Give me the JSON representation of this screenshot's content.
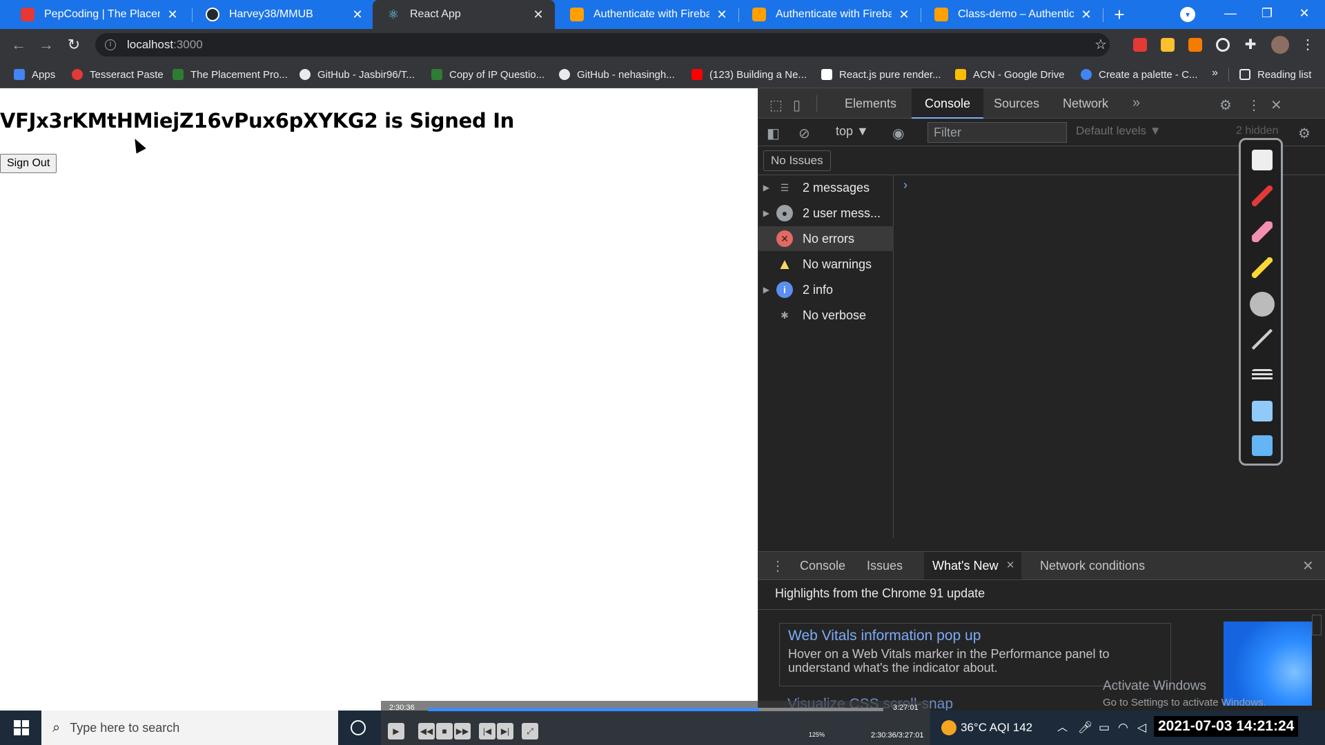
{
  "tabs": [
    {
      "title": "PepCoding | The Placement",
      "close": "✕",
      "color": "#e53935"
    },
    {
      "title": "Harvey38/MMUB",
      "close": "✕",
      "color": "#24292e"
    },
    {
      "title": "React App",
      "close": "✕",
      "color": "#61dafb"
    },
    {
      "title": "Authenticate with Firebase",
      "close": "✕",
      "color": "#ffa000"
    },
    {
      "title": "Authenticate with Firebase",
      "close": "✕",
      "color": "#ffa000"
    },
    {
      "title": "Class-demo – Authenticatio",
      "close": "✕",
      "color": "#ffa000"
    }
  ],
  "window": {
    "new_tab": "+",
    "minimize": "—",
    "restore": "❐",
    "close": "✕"
  },
  "address": {
    "host": "localhost",
    "port": ":3000"
  },
  "bookmarks": [
    {
      "label": "Apps",
      "color": "#4285f4"
    },
    {
      "label": "Tesseract Paste",
      "color": "#e53935"
    },
    {
      "label": "The Placement Pro...",
      "color": "#2e7d32"
    },
    {
      "label": "GitHub - Jasbir96/T...",
      "color": "#e8eaed"
    },
    {
      "label": "Copy of IP Questio...",
      "color": "#2e7d32"
    },
    {
      "label": "GitHub - nehasingh...",
      "color": "#e8eaed"
    },
    {
      "label": "(123) Building a Ne...",
      "color": "#ff0000"
    },
    {
      "label": "React.js pure render...",
      "color": "#ffffff"
    },
    {
      "label": "ACN - Google Drive",
      "color": "#fbbc04"
    },
    {
      "label": "Create a palette - C...",
      "color": "#4285f4"
    }
  ],
  "bookmarks_more": "»",
  "reading_list": "Reading list",
  "page": {
    "heading": "VFJx3rKMtHMiejZ16vPux6pXYKG2 is Signed In",
    "sign_out": "Sign Out"
  },
  "devtools": {
    "tabs": [
      "Elements",
      "Console",
      "Sources",
      "Network"
    ],
    "more_tabs": "»",
    "context": "top ▼",
    "filter_placeholder": "Filter",
    "levels": "Default levels ▼",
    "hidden": "2 hidden",
    "no_issues": "No Issues",
    "sidebar": [
      {
        "label": "2 messages",
        "icon": "list-icon",
        "expandable": true
      },
      {
        "label": "2 user mess...",
        "icon": "user-icon",
        "expandable": true
      },
      {
        "label": "No errors",
        "icon": "error-icon",
        "expandable": false
      },
      {
        "label": "No warnings",
        "icon": "warning-icon",
        "expandable": false
      },
      {
        "label": "2 info",
        "icon": "info-icon",
        "expandable": true
      },
      {
        "label": "No verbose",
        "icon": "bug-icon",
        "expandable": false
      }
    ],
    "prompt": "›",
    "drawer_tabs": [
      "Console",
      "Issues",
      "What's New",
      "Network conditions"
    ],
    "whats_new": {
      "title": "Highlights from the Chrome 91 update",
      "card_title": "Web Vitals information pop up",
      "card_text": "Hover on a Web Vitals marker in the Performance panel to understand what's the indicator about.",
      "next_title": "Visualize CSS scroll-snap"
    }
  },
  "activate": {
    "line1": "Activate Windows",
    "line2": "Go to Settings to activate Windows."
  },
  "taskbar": {
    "search_placeholder": "Type here to search",
    "media_elapsed": "2:30:36",
    "media_total": "3:27:01",
    "media_progress": 0.727,
    "media_pos": "2:30:36/3:27:01",
    "volume": "125%",
    "weather": "36°C  AQI 142",
    "clock": "2021-07-03  14:21:24"
  }
}
